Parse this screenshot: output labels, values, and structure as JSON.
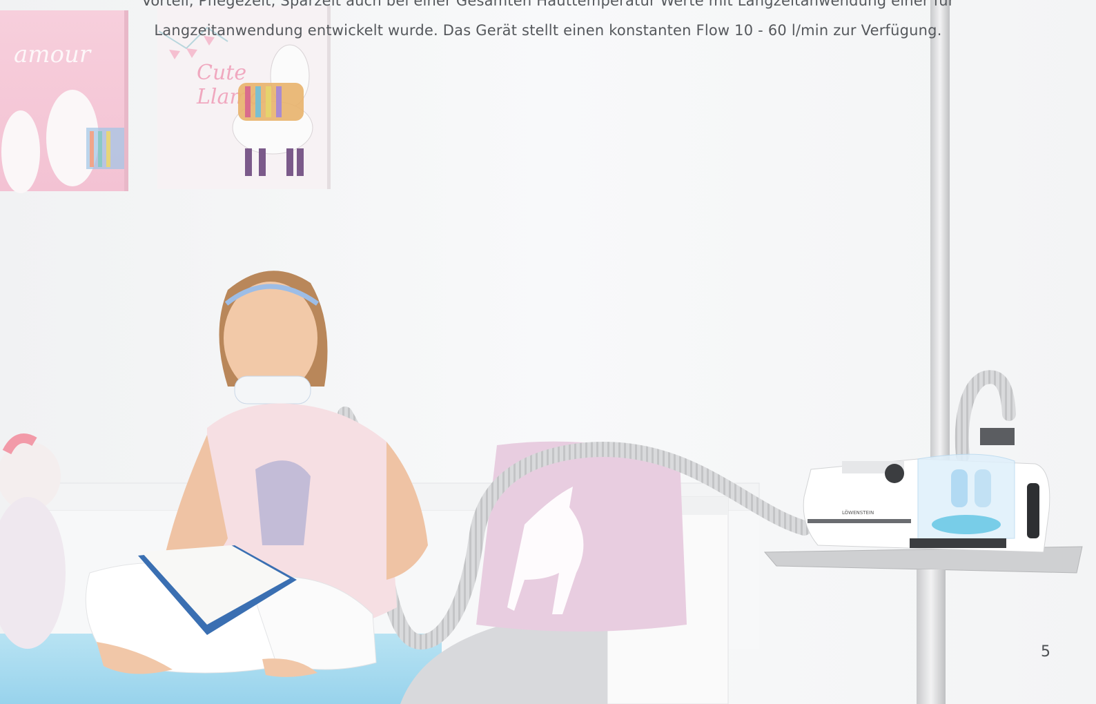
{
  "caption": {
    "line1": "Vorteil, Pflegezeit, Sparzeit auch bei einer Gesamten Hauttemperatur Werte mit Langzeitanwendung einer für",
    "line2": "Langzeitanwendung entwickelt wurde. Das Gerät stellt einen konstanten Flow 10 - 60 l/min zur Verfügung."
  },
  "page_number": "5",
  "device": {
    "brand_label": "LÖWENSTEIN"
  },
  "colors": {
    "wall": "#f6f7f8",
    "mattress": "#a9dcf0",
    "pillow": "#e9cfe0",
    "device": "#ffffff",
    "text": "#55585c"
  }
}
